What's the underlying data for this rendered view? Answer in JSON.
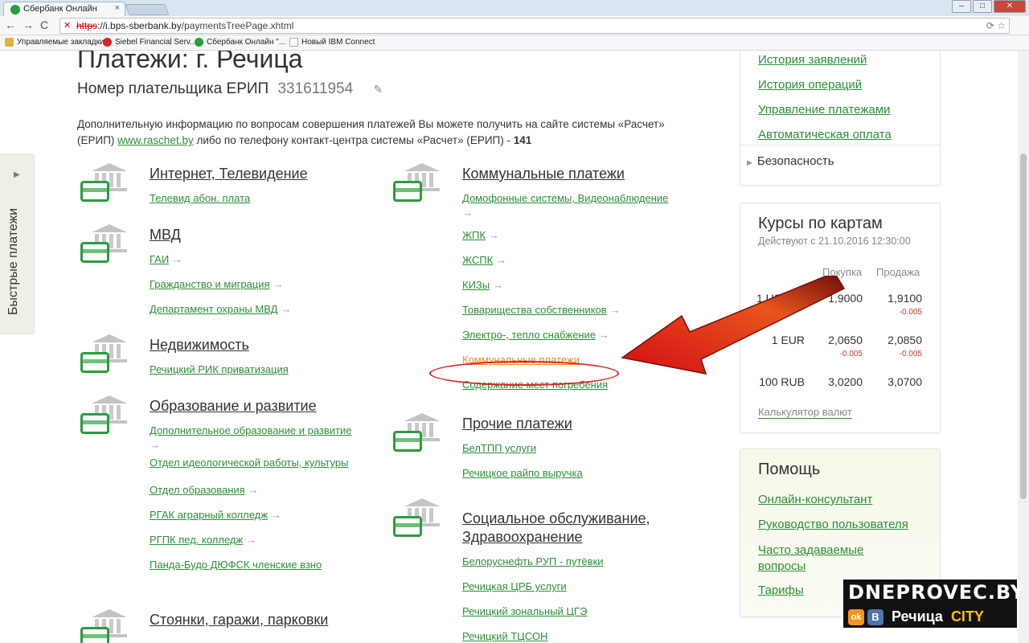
{
  "browser": {
    "tab_title": "Сбербанк Онлайн",
    "tab_close": "×",
    "url_scheme": "https",
    "url_host": "://i.bps-sberbank.by",
    "url_path": "/paymentsTreePage.xhtml",
    "bookmarks": [
      {
        "label": "Управляемые закладки"
      },
      {
        "label": "Siebel Financial Serv..."
      },
      {
        "label": "Сбербанк Онлайн \"..."
      },
      {
        "label": "Новый IBM Connect"
      }
    ]
  },
  "quick_payments_label": "Быстрые платежи",
  "page": {
    "title": "Платежи: г. Речица",
    "payer_label": "Номер плательщика ЕРИП",
    "payer_number": "331611954",
    "info_text_1": "Дополнительную информацию по вопросам совершения платежей Вы можете получить на сайте системы «Расчет» (ЕРИП)",
    "info_link": "www.raschet.by",
    "info_text_2": "либо по телефону контакт-центра системы «Расчет» (ЕРИП) -",
    "info_phone": "141"
  },
  "categories_left": [
    {
      "title": "Интернет, Телевидение",
      "items": [
        {
          "label": "Телевид абон. плата",
          "arrow": false
        }
      ]
    },
    {
      "title": "МВД",
      "items": [
        {
          "label": "ГАИ",
          "arrow": true
        },
        {
          "label": "Гражданство и миграция",
          "arrow": true
        },
        {
          "label": "Департамент охраны МВД",
          "arrow": true
        }
      ]
    },
    {
      "title": "Недвижимость",
      "items": [
        {
          "label": "Речицкий РИК приватизация",
          "arrow": false
        }
      ]
    },
    {
      "title": "Образование и развитие",
      "items": [
        {
          "label": "Дополнительное образование и развитие",
          "arrow": true
        },
        {
          "label": "Отдел идеологической работы, культуры",
          "arrow": false
        },
        {
          "label": "Отдел образования",
          "arrow": true
        },
        {
          "label": "РГАК аграрный колледж",
          "arrow": true
        },
        {
          "label": "РГПК пед. колледж",
          "arrow": true
        },
        {
          "label": "Панда-Будо ДЮФСК членские взно",
          "arrow": false
        }
      ]
    },
    {
      "title": "Стоянки, гаражи, парковки",
      "items": []
    }
  ],
  "categories_right": [
    {
      "title": "Коммунальные платежи",
      "items": [
        {
          "label": "Домофонные системы, Видеонаблюдение",
          "arrow": true
        },
        {
          "label": "ЖПК",
          "arrow": true
        },
        {
          "label": "ЖСПК",
          "arrow": true
        },
        {
          "label": "КИЗы",
          "arrow": true
        },
        {
          "label": "Товарищества собственников",
          "arrow": true
        },
        {
          "label": "Электро-, тепло снабжение",
          "arrow": true
        },
        {
          "label": "Коммунальные платежи",
          "arrow": false,
          "highlight": true
        },
        {
          "label": "Содержание мест погребения",
          "arrow": false
        }
      ]
    },
    {
      "title": "Прочие платежи",
      "items": [
        {
          "label": "БелТПП услуги",
          "arrow": false
        },
        {
          "label": "Речицкое райпо выручка",
          "arrow": false
        }
      ]
    },
    {
      "title": "Социальное обслуживание, Здравоохранение",
      "items": [
        {
          "label": "Белоруснефть РУП - путёвки",
          "arrow": false
        },
        {
          "label": "Речицкая ЦРБ услуги",
          "arrow": false
        },
        {
          "label": "Речицкий зональный ЦГЭ",
          "arrow": false
        },
        {
          "label": "Речицкий ТЦСОН",
          "arrow": false
        }
      ]
    }
  ],
  "sidebar": {
    "links": [
      "История заявлений",
      "История операций",
      "Управление платежами",
      "Автоматическая оплата"
    ],
    "security": "Безопасность",
    "rates": {
      "title": "Курсы по картам",
      "subtitle": "Действуют с 21.10.2016 12:30:00",
      "col_buy": "Покупка",
      "col_sell": "Продажа",
      "rows": [
        {
          "currency": "1 USD",
          "buy": "1,9000",
          "sell": "1,9100",
          "buy_delta": "",
          "sell_delta": "-0.005"
        },
        {
          "currency": "1 EUR",
          "buy": "2,0650",
          "sell": "2,0850",
          "buy_delta": "-0.005",
          "sell_delta": "-0.005"
        },
        {
          "currency": "100 RUB",
          "buy": "3,0200",
          "sell": "3,0700",
          "buy_delta": "",
          "sell_delta": ""
        }
      ],
      "calculator": "Калькулятор валют"
    },
    "help": {
      "title": "Помощь",
      "links": [
        "Онлайн-консультант",
        "Руководство пользователя",
        "Часто задаваемые вопросы",
        "Тарифы"
      ]
    }
  },
  "watermark": {
    "site": "DNEPROVEC.BY",
    "ok": "ok",
    "vk": "В",
    "city_1": "Речица",
    "city_2": "CITY"
  },
  "colors": {
    "accent": "#2b8f38",
    "highlight": "#f08a24",
    "annotation": "#d6242a"
  }
}
